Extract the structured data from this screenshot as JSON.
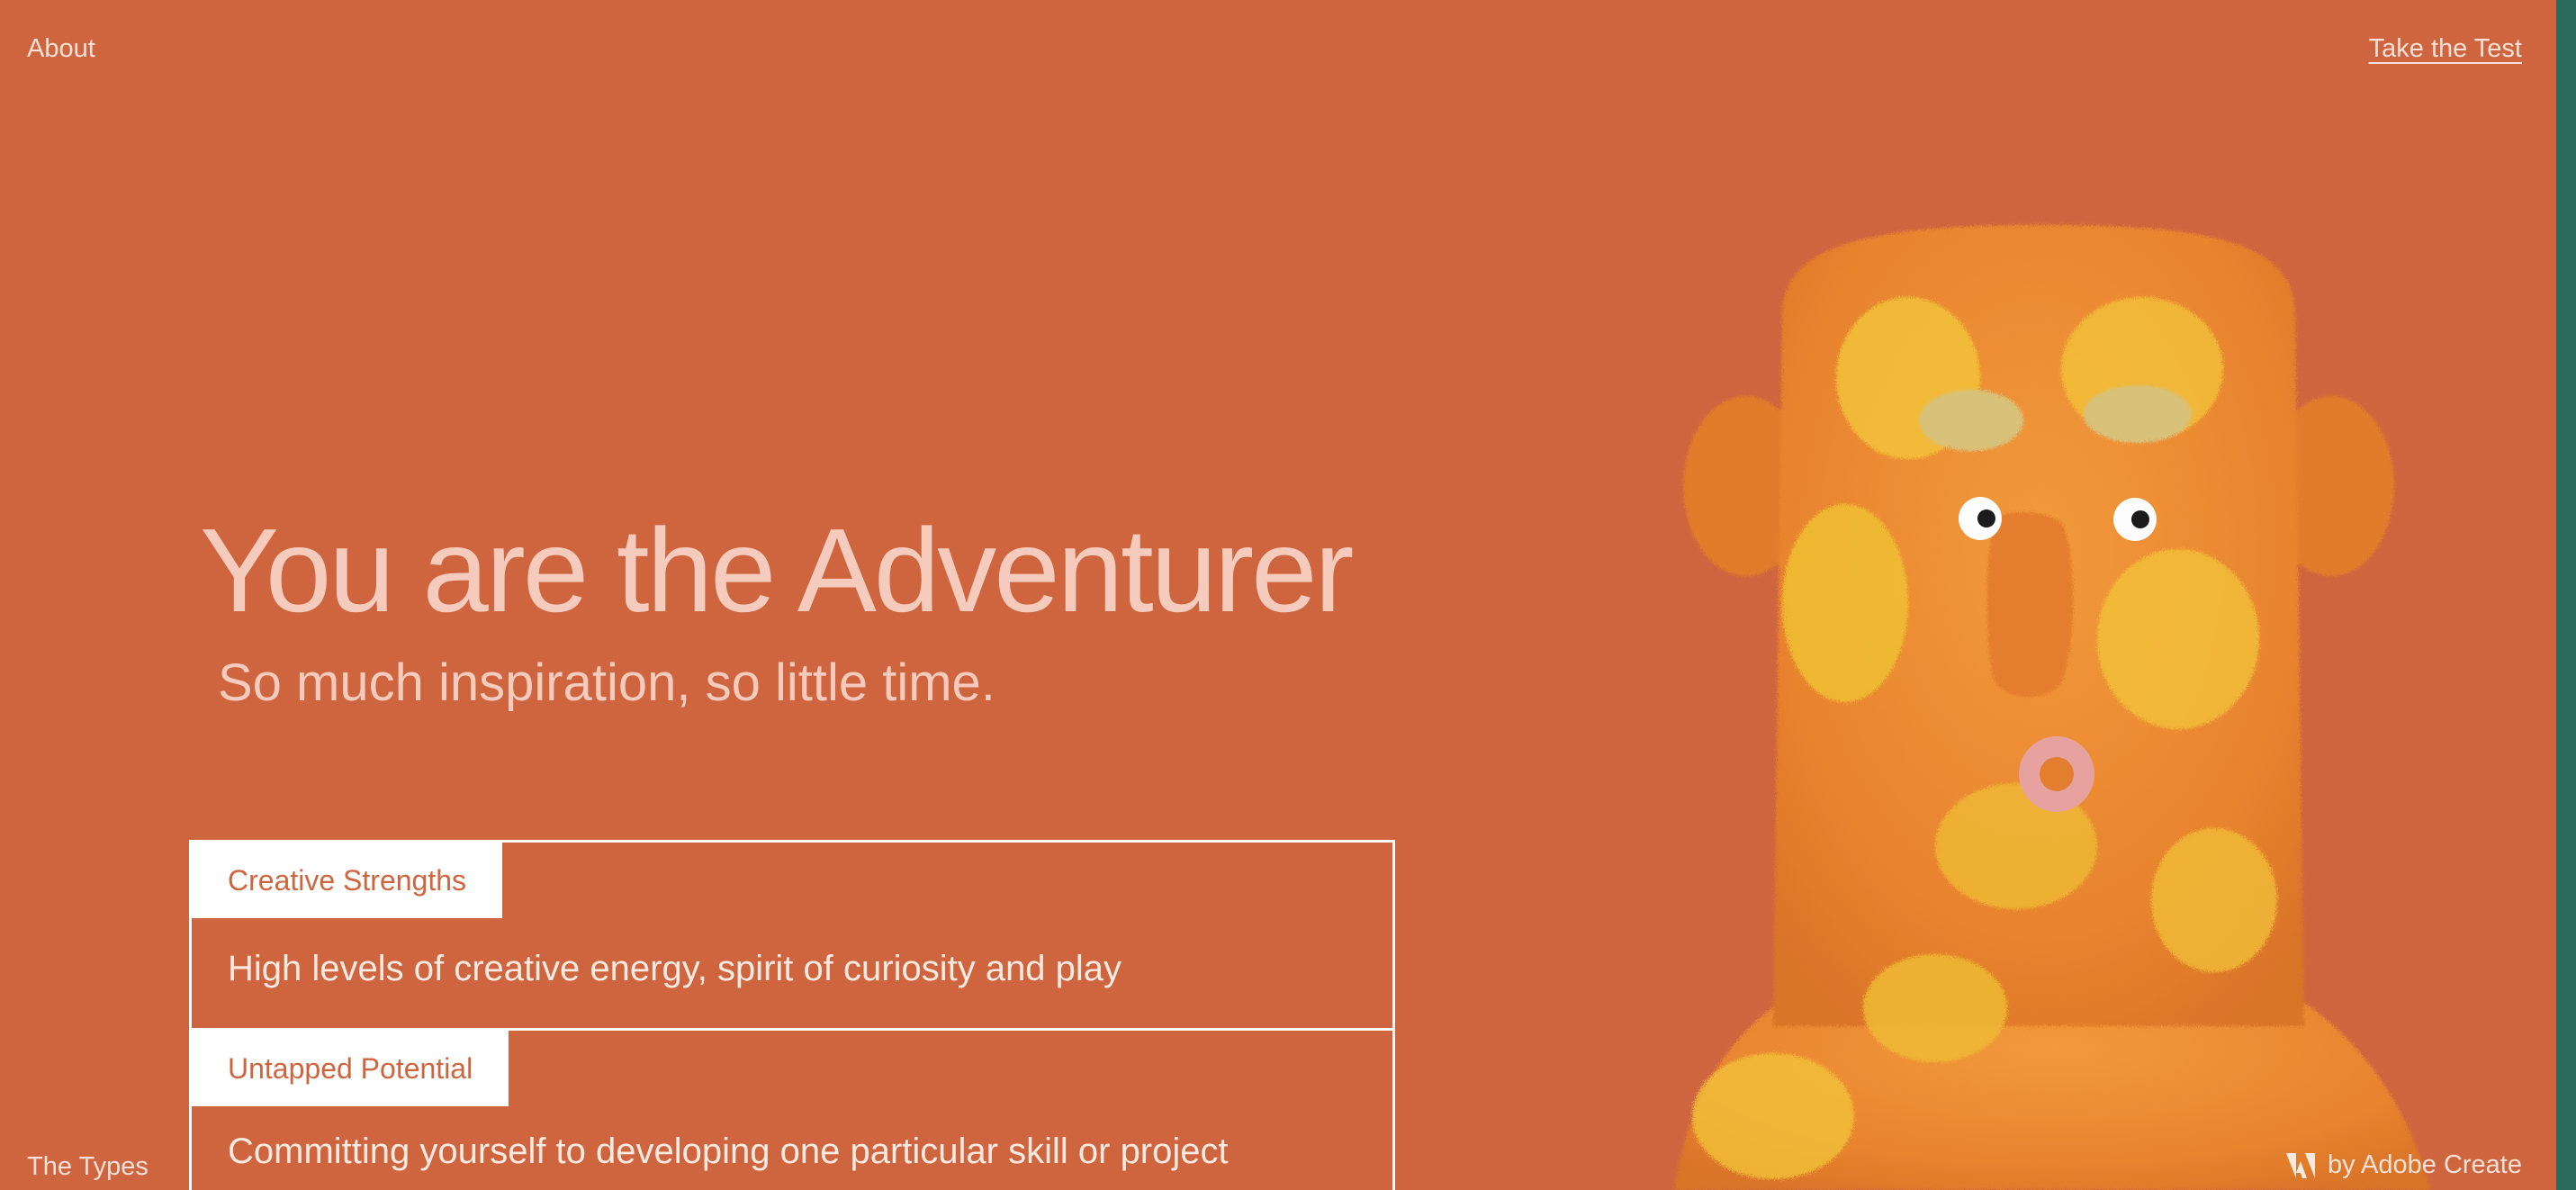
{
  "nav": {
    "about": "About",
    "take_test": "Take the Test",
    "types": "The Types",
    "credit": "by Adobe Create"
  },
  "hero": {
    "title": "You are the Adventurer",
    "subtitle": "So much inspiration, so little time."
  },
  "cards": [
    {
      "tab": "Creative Strengths",
      "text": "High levels of creative energy, spirit of curiosity and play"
    },
    {
      "tab": "Untapped Potential",
      "text": "Committing yourself to developing one particular skill or project"
    }
  ],
  "colors": {
    "background": "#cf653e",
    "accent_strip": "#2a6b5c",
    "title_text": "#f5cbbd",
    "card_border": "#ffffff"
  },
  "icons": {
    "brand": "adobe-logo-icon"
  }
}
